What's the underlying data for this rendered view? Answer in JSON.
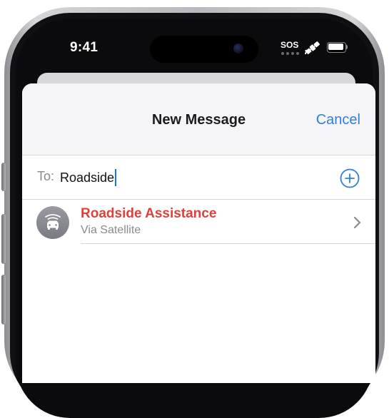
{
  "status_bar": {
    "time": "9:41",
    "sos": "SOS",
    "icons": [
      "satellite-icon",
      "battery-icon"
    ],
    "battery_level": 1.0
  },
  "sheet": {
    "title": "New Message",
    "cancel_label": "Cancel"
  },
  "recipient": {
    "label": "To:",
    "value": "Roadside",
    "add_icon": "plus-circle-icon"
  },
  "suggestions": [
    {
      "name": "Roadside Assistance",
      "subtitle": "Via Satellite",
      "icon": "car-icon",
      "accessory": "chevron-right-icon"
    }
  ],
  "colors": {
    "accent": "#2f7fd8",
    "suggestion_name": "#e0403a",
    "secondary_text": "#8a8a8e",
    "header_background": "#f5f5f7"
  }
}
